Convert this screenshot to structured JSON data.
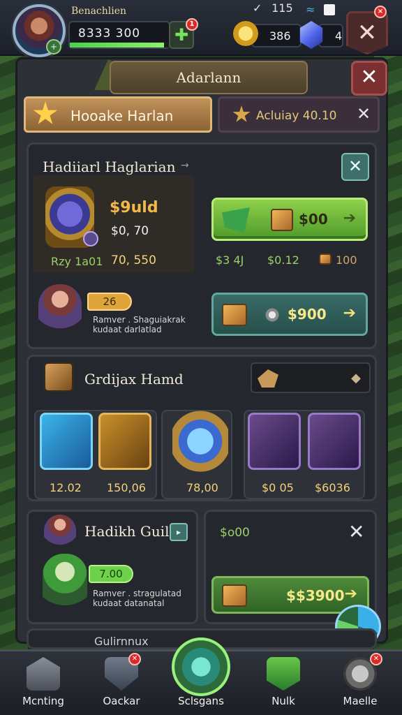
{
  "status_bar": {
    "time": "115"
  },
  "player": {
    "name": "Benachlien",
    "xp_value": "8333 300",
    "xp_progress": 0.95,
    "add_badge": "1"
  },
  "currency": {
    "gold": "386",
    "gems": "4"
  },
  "top_close_badge": "×",
  "header": {
    "title": "Adarlann",
    "close_label": "✕"
  },
  "tabs": [
    {
      "label": "Hooake Harlan",
      "active": true
    },
    {
      "label": "Acluiay 40.10",
      "active": false,
      "close_label": "✕"
    }
  ],
  "guild_panel": {
    "title": "Hadiiarl Haglarian",
    "title_arrow": "→",
    "close_label": "✕",
    "guild_name": "$9uld",
    "guild_value": "$0, 70",
    "level_label": "Rzy 1a01",
    "level_value": "70, 550",
    "buy_button": {
      "value": "$00",
      "arrow": "➔"
    },
    "price_row": [
      "$3 4J",
      "$0.12",
      "100"
    ],
    "hero_level": "26",
    "hero_desc": [
      "Ramver . Shaguiakrak",
      "kudaat darlatlad"
    ],
    "crate_button": {
      "value": "$900",
      "arrow": "➔"
    }
  },
  "items_panel": {
    "title": "Grdijax Hamd",
    "items": [
      {
        "price": "12.02"
      },
      {
        "price": "150,06"
      },
      {
        "price": "78,00"
      },
      {
        "price": "$0 05"
      },
      {
        "price": "$6036"
      }
    ]
  },
  "guild2_panel": {
    "title": "Hadikh Guild",
    "hero_level": "7.00",
    "hero_desc": [
      "Ramver . stragulatad",
      "kudaat datanatal"
    ],
    "side_label": "$o00",
    "close_label": "✕",
    "crate_button": {
      "value": "$$3900",
      "arrow": "➔"
    }
  },
  "partial_panel": {
    "label": "Gulirnnux"
  },
  "bottom_nav": [
    {
      "label": "Mcnting"
    },
    {
      "label": "Oackar"
    },
    {
      "label": "Sclsgans"
    },
    {
      "label": "Nulk"
    },
    {
      "label": "Maelle"
    }
  ]
}
